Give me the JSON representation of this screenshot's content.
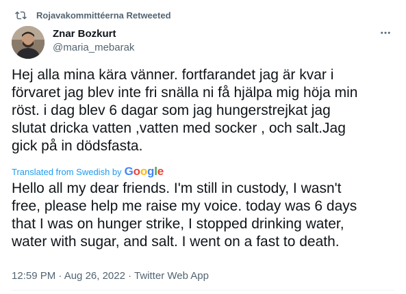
{
  "retweet": {
    "label": "Rojavakommittéerna Retweeted"
  },
  "author": {
    "display_name": "Znar Bozkurt",
    "handle": "@maria_mebarak"
  },
  "tweet": {
    "text": "Hej alla mina kära vänner. fortfarandet jag är kvar i\nförvaret jag blev inte fri snälla ni få hjälpa mig höja min\nröst. i dag blev 6 dagar som jag hungerstrejkat  jag\nslutat dricka vatten ,vatten med socker , och salt.Jag\ngick på in dödsfasta.",
    "translated_from": "Translated from Swedish by",
    "translation_provider": "Google",
    "translation": "Hello all my dear friends. I'm still in custody, I wasn't\nfree, please help me raise my voice. today was 6 days\nthat I was on hunger strike, I stopped drinking water,\nwater with sugar, and salt. I went on a fast to death.",
    "timestamp": "12:59 PM · Aug 26, 2022 · Twitter Web App"
  },
  "icons": {
    "retweet": "retweet-icon",
    "more": "more-icon",
    "avatar": "avatar"
  },
  "colors": {
    "text": "#0f1419",
    "secondary": "#536471",
    "link": "#1d9bf0"
  }
}
